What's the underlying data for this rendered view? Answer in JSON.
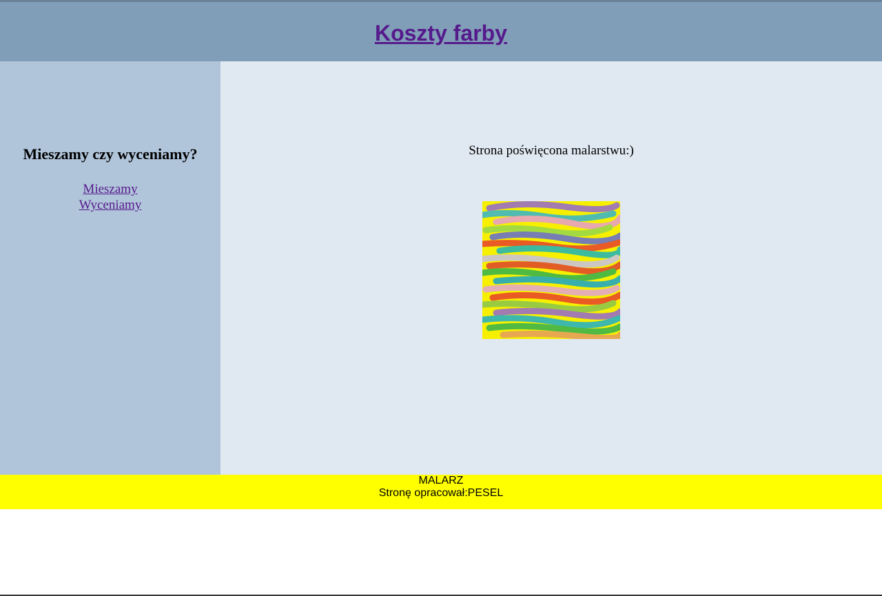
{
  "header": {
    "title": "Koszty farby"
  },
  "sidebar": {
    "heading": "Mieszamy czy wyceniamy?",
    "links": [
      {
        "label": "Mieszamy"
      },
      {
        "label": "Wyceniamy"
      }
    ]
  },
  "main": {
    "text": "Strona poświęcona malarstwu:)",
    "image_icon": "abstract-painting-image"
  },
  "footer": {
    "line1": "MALARZ",
    "line2": "Stronę opracował:PESEL"
  },
  "colors": {
    "header_bg": "#819eb8",
    "sidebar_bg": "#b0c4da",
    "main_bg": "#e0e8f2",
    "footer_bg": "#ffff00",
    "link": "#551a8b"
  }
}
